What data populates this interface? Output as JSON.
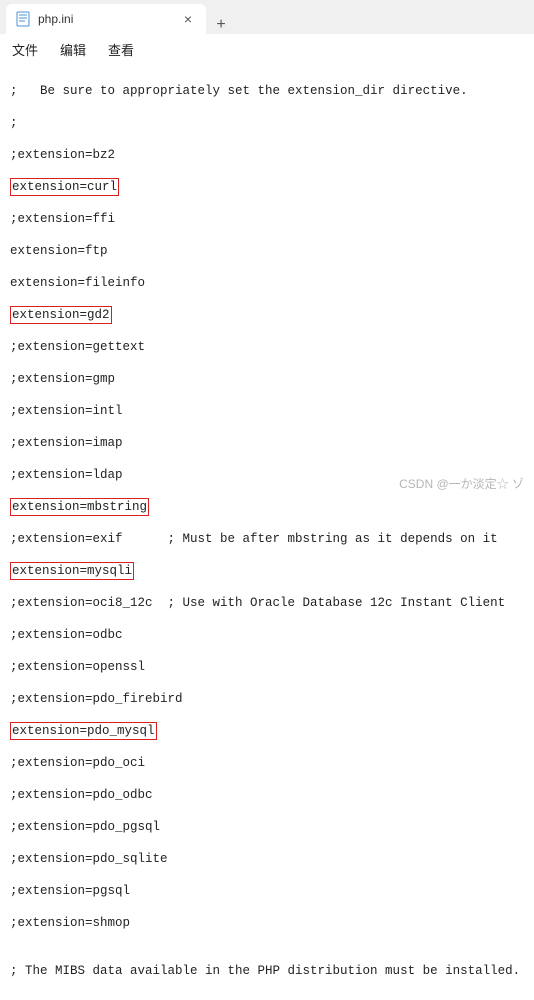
{
  "tab": {
    "filename": "php.ini",
    "close": "×",
    "new": "+"
  },
  "menu": {
    "file": "文件",
    "edit": "编辑",
    "view": "查看"
  },
  "lines": {
    "l0": ";   Be sure to appropriately set the extension_dir directive.",
    "l1": ";",
    "l2": ";extension=bz2",
    "l3": "extension=curl",
    "l4": ";extension=ffi",
    "l5": "extension=ftp",
    "l6": "extension=fileinfo",
    "l7": "extension=gd2",
    "l8": ";extension=gettext",
    "l9": ";extension=gmp",
    "l10": ";extension=intl",
    "l11": ";extension=imap",
    "l12": ";extension=ldap",
    "l13": "extension=mbstring",
    "l14": ";extension=exif      ; Must be after mbstring as it depends on it",
    "l15": "extension=mysqli",
    "l16": ";extension=oci8_12c  ; Use with Oracle Database 12c Instant Client",
    "l17": ";extension=odbc",
    "l18": ";extension=openssl",
    "l19": ";extension=pdo_firebird",
    "l20": "extension=pdo_mysql",
    "l21": ";extension=pdo_oci",
    "l22": ";extension=pdo_odbc",
    "l23": ";extension=pdo_pgsql",
    "l24": ";extension=pdo_sqlite",
    "l25": ";extension=pgsql",
    "l26": ";extension=shmop",
    "l27": "",
    "l28": "; The MIBS data available in the PHP distribution must be installed."
  },
  "watermark": "CSDN @一か淡定☆ ゾ"
}
